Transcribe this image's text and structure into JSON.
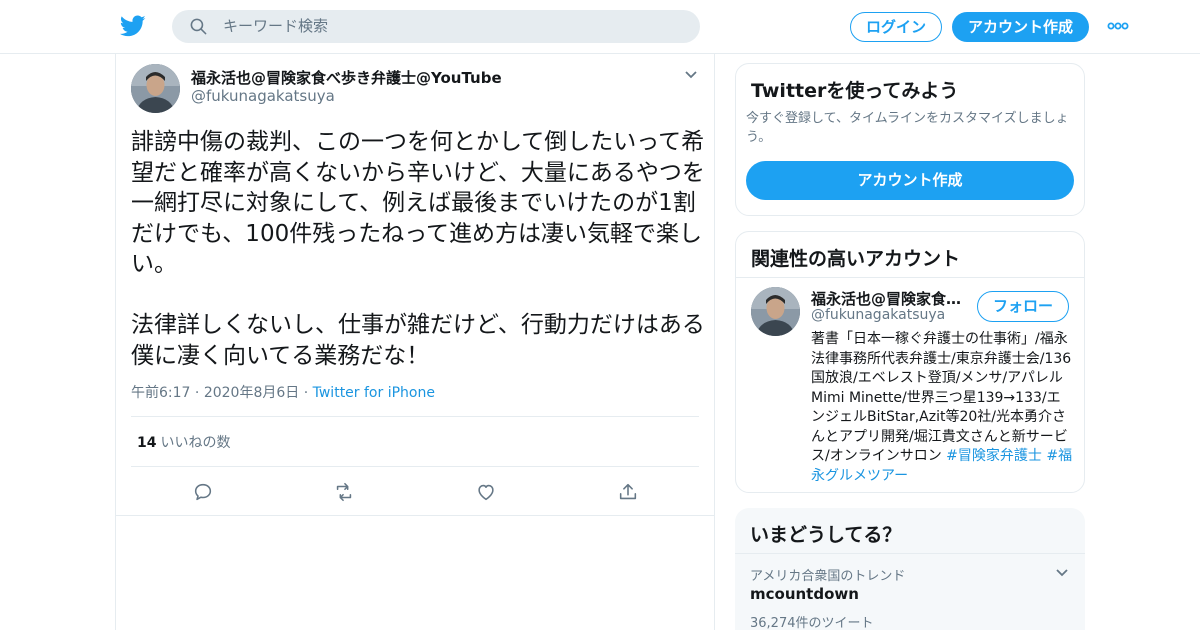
{
  "header": {
    "search_placeholder": "キーワード検索",
    "login_label": "ログイン",
    "signup_label": "アカウント作成"
  },
  "tweet": {
    "author_name": "福永活也@冒険家食べ歩き弁護士@YouTube",
    "author_handle": "@fukunagakatsuya",
    "text": "誹謗中傷の裁判、この一つを何とかして倒したいって希望だと確率が高くないから辛いけど、大量にあるやつを一網打尽に対象にして、例えば最後までいけたのが1割だけでも、100件残ったねって進め方は凄い気軽で楽しい。\n\n法律詳しくないし、仕事が雑だけど、行動力だけはある僕に凄く向いてる業務だな！",
    "time": "午前6:17",
    "date": "2020年8月6日",
    "source": "Twitter for iPhone",
    "likes_count": "14",
    "likes_label": "いいねの数"
  },
  "signup_card": {
    "title": "Twitterを使ってみよう",
    "description": "今すぐ登録して、タイムラインをカスタマイズしましょう。",
    "cta_label": "アカウント作成"
  },
  "related": {
    "title": "関連性の高いアカウント",
    "name": "福永活也@冒険家食べ歩き弁護士@YouTube",
    "handle": "@fukunagakatsuya",
    "follow_label": "フォロー",
    "bio": "著書「日本一稼ぐ弁護士の仕事術」/福永法律事務所代表弁護士/東京弁護士会/136国放浪/エベレスト登頂/メンサ/アパレルMimi Minette/世界三つ星139→133/エンジェルBitStar,Azit等20社/光本勇介さんとアプリ開発/堀江貴文さんと新サービス/オンラインサロン",
    "hashtag1": "#冒険家弁護士",
    "hashtag2": "#福永グルメツアー"
  },
  "trends": {
    "title": "いまどうしてる？",
    "location_label": "アメリカ合衆国のトレンド",
    "trend_name": "mcountdown",
    "tweet_count": "36,274件のツイート"
  },
  "colors": {
    "accent": "#1da1f2",
    "link": "#1b95e0",
    "muted": "#657786",
    "border": "#e6ecf0"
  }
}
